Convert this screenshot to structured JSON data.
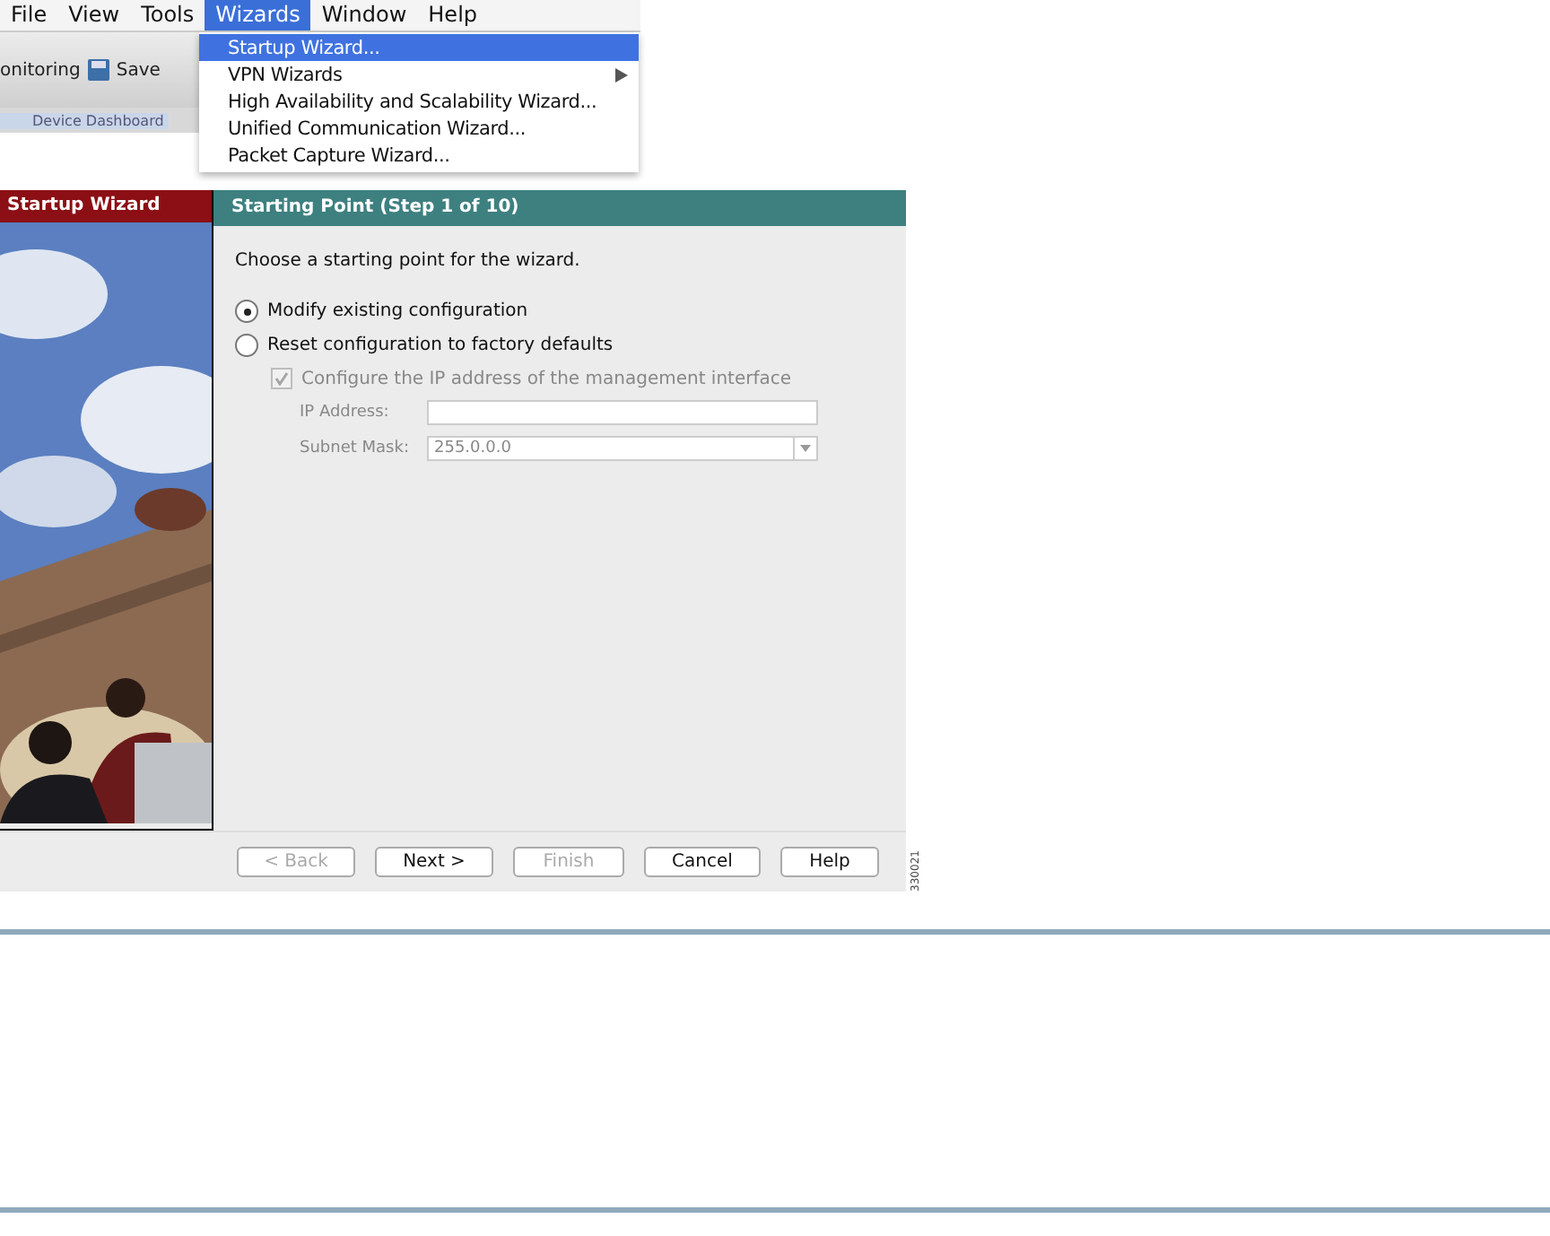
{
  "menu_bar": [
    {
      "label": "File",
      "selected": false
    },
    {
      "label": "View",
      "selected": false
    },
    {
      "label": "Tools",
      "selected": false
    },
    {
      "label": "Wizards",
      "selected": true
    },
    {
      "label": "Window",
      "selected": false
    },
    {
      "label": "Help",
      "selected": false
    }
  ],
  "toolbar": {
    "items": [
      "onitoring",
      "Save"
    ],
    "tab": "Device Dashboard"
  },
  "wizards_menu": [
    {
      "label": "Startup Wizard...",
      "selected": true,
      "submenu": false
    },
    {
      "label": "VPN Wizards",
      "selected": false,
      "submenu": true
    },
    {
      "label": "High Availability and Scalability Wizard...",
      "selected": false,
      "submenu": false
    },
    {
      "label": "Unified Communication Wizard...",
      "selected": false,
      "submenu": false
    },
    {
      "label": "Packet Capture Wizard...",
      "selected": false,
      "submenu": false
    }
  ],
  "wizard": {
    "title": "Startup Wizard",
    "step_title": "Starting Point  (Step 1 of 10)",
    "prompt": "Choose a starting point for the wizard.",
    "options": [
      {
        "label": "Modify existing configuration",
        "selected": true
      },
      {
        "label": "Reset configuration to factory defaults",
        "selected": false
      }
    ],
    "checkbox": {
      "label": "Configure the IP address of the management interface",
      "checked": true,
      "disabled": true
    },
    "fields": [
      {
        "kind": "text",
        "label": "IP Address:"
      },
      {
        "kind": "select",
        "label": "Subnet Mask:",
        "value": "255.0.0.0"
      }
    ],
    "buttons": [
      {
        "label": "< Back",
        "disabled": true
      },
      {
        "label": "Next >",
        "disabled": false
      },
      {
        "label": "Finish",
        "disabled": true
      },
      {
        "label": "Cancel",
        "disabled": false
      },
      {
        "label": "Help",
        "disabled": false
      }
    ]
  },
  "figure_number": "330021"
}
